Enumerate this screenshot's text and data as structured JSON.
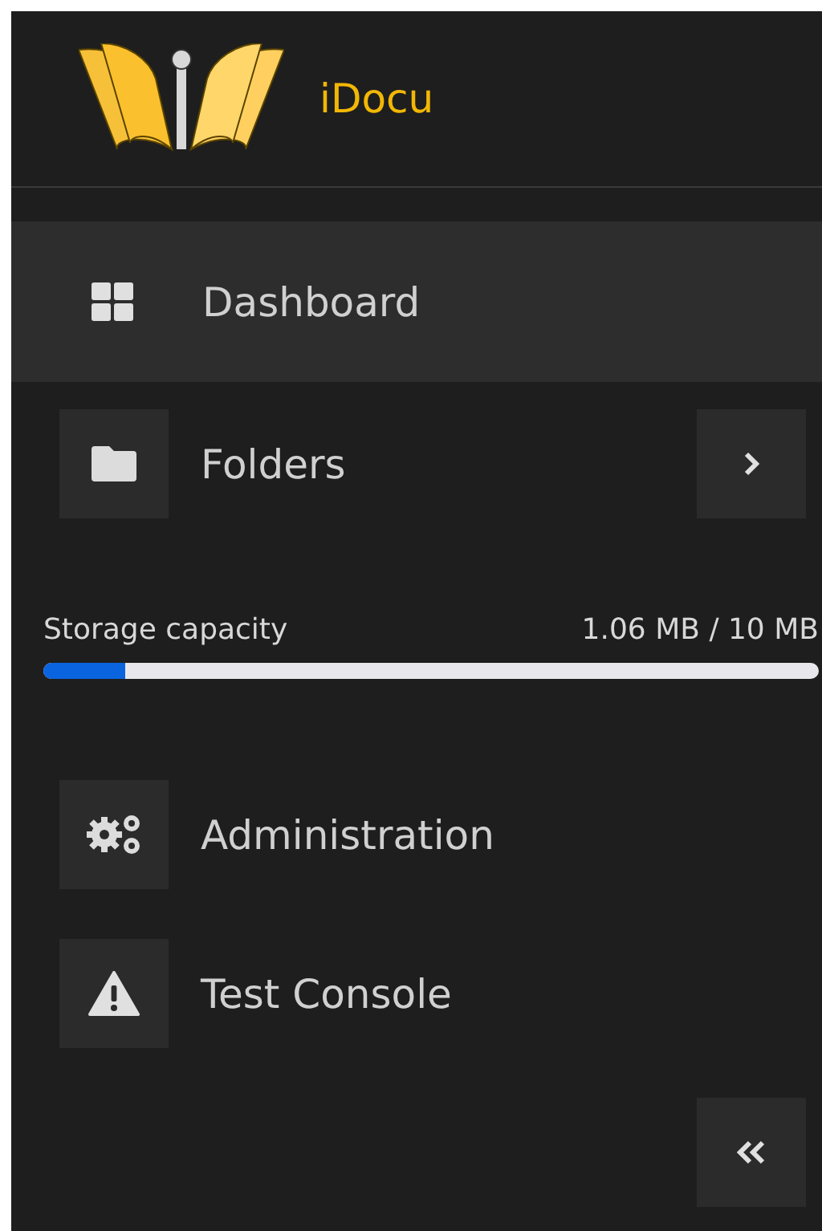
{
  "brand": {
    "name": "iDocu"
  },
  "nav": [
    {
      "label": "Dashboard",
      "selected": true,
      "kind": "link"
    },
    {
      "label": "Folders",
      "selected": false,
      "kind": "group"
    }
  ],
  "storage": {
    "label": "Storage capacity",
    "reading": "1.06 MB / 10 MB",
    "level": 0.106
  },
  "nav_bottom": [
    {
      "label": "Administration",
      "selected": false
    },
    {
      "label": "Test Console",
      "selected": false
    }
  ]
}
